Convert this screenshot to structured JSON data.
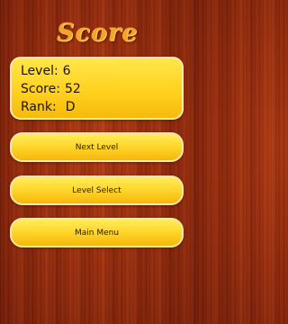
{
  "title": "Score",
  "stats": {
    "level_label": "Level:",
    "level_value": "6",
    "score_label": "Score:",
    "score_value": "52",
    "rank_label": "Rank:",
    "rank_value": "D"
  },
  "buttons": {
    "next_level": "Next Level",
    "level_select": "Level Select",
    "main_menu": "Main Menu"
  }
}
